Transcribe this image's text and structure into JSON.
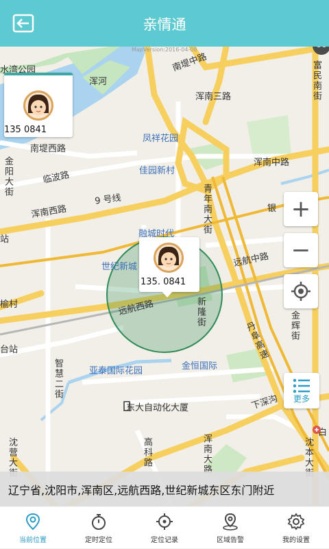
{
  "header": {
    "title": "亲情通"
  },
  "map": {
    "version": "MapVersion:2016-04-08",
    "labels": {
      "park": "水湾公园",
      "hunhe": "浑河",
      "nandi_zhonglu": "南堤中路",
      "hunnan_sanlu": "浑南三路",
      "fumin_nanjie": "富民南街",
      "fengxiang": "凤祥花园",
      "nandi_xilu": "南堤西路",
      "jinyang": "金阳大街",
      "linbo": "临波路",
      "jiayuan": "佳园新村",
      "hunnan_zhonglu": "浑南中路",
      "line9": "9 号线",
      "qingnian": "青年南大街",
      "hunnan_xilu": "浑南西路",
      "yin": "银",
      "rongcheng": "融城时代",
      "yuanhang_zhonglu": "远航中路",
      "shijicheng": "世纪新城",
      "yuanhang_xilu": "远航西路",
      "xinlong": "新隆街",
      "jinhui": "金辉街",
      "danfu": "丹阜高速",
      "zhihui": "智慧二街",
      "yatai": "亚泰国际花园",
      "jinheng": "金恒国际",
      "dongda": "东大自动化大厦",
      "xiashen": "下深沟",
      "shenying": "沈营大街",
      "gaoke": "高科路",
      "hunnan_dalu": "浑南大路",
      "shenben": "沈本大街",
      "zhan": "站",
      "yushu": "榆村",
      "taizhan": "台站",
      "bai": "白"
    },
    "markers": [
      {
        "phone": "135       0841"
      },
      {
        "phone": "135.       0841"
      }
    ]
  },
  "controls": {
    "zoom_in": "+",
    "zoom_out": "−",
    "more_label": "更多"
  },
  "address": "辽宁省,沈阳市,浑南区,远航西路,世纪新城东区东门附近",
  "tabs": [
    {
      "label": "当前位置",
      "icon": "location-pin-icon",
      "active": true
    },
    {
      "label": "定时定位",
      "icon": "stopwatch-icon",
      "active": false
    },
    {
      "label": "定位记录",
      "icon": "crosshair-icon",
      "active": false
    },
    {
      "label": "区域告警",
      "icon": "area-alarm-icon",
      "active": false
    },
    {
      "label": "我的设置",
      "icon": "gear-icon",
      "active": false
    }
  ],
  "colors": {
    "header": "#5dc9d1",
    "accent": "#2a9cc6",
    "geofence": "#2e8b57"
  }
}
